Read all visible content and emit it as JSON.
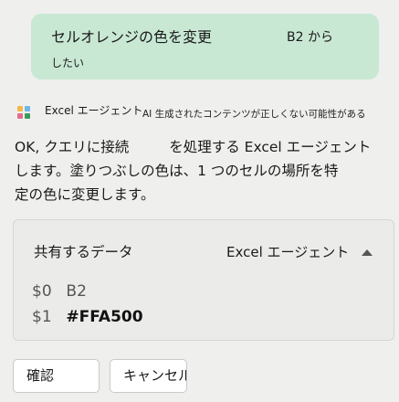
{
  "user_message": {
    "text_main": "セルオレンジの色を変更",
    "text_cell": "B2 から",
    "text_tail": "したい"
  },
  "agent": {
    "name": "Excel エージェント",
    "ai_disclaimer": "AI 生成されたコンテンツが正しくない可能性がある",
    "logo_icon": "excel-agent-logo-icon",
    "response_line1_a": "OK, クエリに接続",
    "response_line1_b": "を処理する Excel エージェント",
    "response_line2": "します。塗りつぶしの色は、1 つのセルの場所を特",
    "response_line3": "定の色に変更します。"
  },
  "shared_data": {
    "title": "共有するデータ",
    "agent_label": "Excel エージェント",
    "toggle_icon": "collapse-triangle-up-icon",
    "params": [
      {
        "key": "$0",
        "value": "B2"
      },
      {
        "key": "$1",
        "value": "#FFA500"
      }
    ]
  },
  "actions": {
    "confirm_label": "確認",
    "cancel_label": "キャンセル"
  },
  "colors": {
    "background": "#efefee",
    "user_bubble": "#c8e8d4",
    "button_bg": "#ffffff"
  }
}
